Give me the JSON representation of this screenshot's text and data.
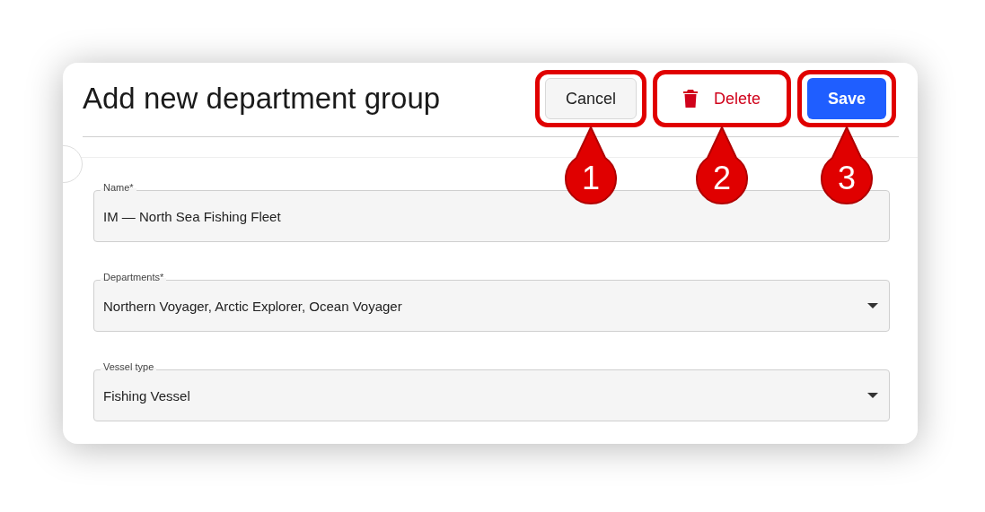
{
  "dialog": {
    "title": "Add new department group"
  },
  "buttons": [
    {
      "kind": "secondary",
      "label": "Cancel",
      "highlighted": true,
      "callout": "1"
    },
    {
      "kind": "danger",
      "label": "Delete",
      "highlighted": true,
      "callout": "2"
    },
    {
      "kind": "primary",
      "label": "Save",
      "highlighted": true,
      "callout": "3"
    }
  ],
  "fields": [
    {
      "kind": "text",
      "label": "Name*",
      "value": "IM — North Sea Fishing Fleet"
    },
    {
      "kind": "select",
      "label": "Departments*",
      "value": "Northern Voyager, Arctic Explorer, Ocean Voyager"
    },
    {
      "kind": "select",
      "label": "Vessel type",
      "value": "Fishing Vessel"
    }
  ]
}
